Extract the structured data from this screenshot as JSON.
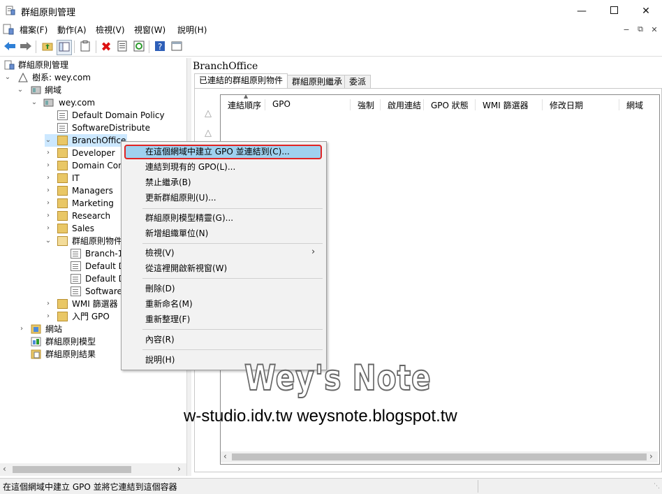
{
  "window": {
    "title": "群組原則管理"
  },
  "menu": [
    "檔案(F)",
    "動作(A)",
    "檢視(V)",
    "視窗(W)",
    "說明(H)"
  ],
  "tree": {
    "root": "群組原則管理",
    "forest": "樹系: wey.com",
    "domains": "網域",
    "domain": "wey.com",
    "default_domain_policy": "Default Domain Policy",
    "software_distribute": "SoftwareDistribute",
    "branch_office": "BranchOffice",
    "developers": "Developer",
    "domain_controllers": "Domain Con",
    "it": "IT",
    "managers": "Managers",
    "marketing": "Marketing",
    "research": "Research",
    "sales": "Sales",
    "gpo_objects": "群組原則物件",
    "gpo_branch": "Branch-1",
    "gpo_default1": "Default D",
    "gpo_default2": "Default D",
    "gpo_software": "Software",
    "wmi_filters": "WMI 篩選器",
    "starter_gpo": "入門 GPO",
    "sites": "網站",
    "gp_modeling": "群組原則模型",
    "gp_results": "群組原則結果"
  },
  "right": {
    "title": "BranchOffice",
    "tabs": [
      "已連結的群組原則物件",
      "群組原則繼承",
      "委派"
    ],
    "columns": [
      "連結順序",
      "GPO",
      "強制",
      "啟用連結",
      "GPO 狀態",
      "WMI 篩選器",
      "修改日期",
      "網域"
    ]
  },
  "context_menu": {
    "create_link": "在這個網域中建立 GPO 並連結到(C)...",
    "link_existing": "連結到現有的 GPO(L)...",
    "block_inheritance": "禁止繼承(B)",
    "gp_update": "更新群組原則(U)...",
    "modeling_wizard": "群組原則模型精靈(G)...",
    "new_ou": "新增組織單位(N)",
    "view": "檢視(V)",
    "new_window": "從這裡開啟新視窗(W)",
    "delete": "刪除(D)",
    "rename": "重新命名(M)",
    "refresh": "重新整理(F)",
    "properties": "內容(R)",
    "help": "說明(H)"
  },
  "status": "在這個網域中建立 GPO 並將它連結到這個容器",
  "watermark": {
    "title": "Wey's Note",
    "urls": "w-studio.idv.tw  weysnote.blogspot.tw"
  },
  "colors": {
    "highlight": "#9fd1ef",
    "highlight_border": "#e02424",
    "folder": "#e9c766"
  }
}
